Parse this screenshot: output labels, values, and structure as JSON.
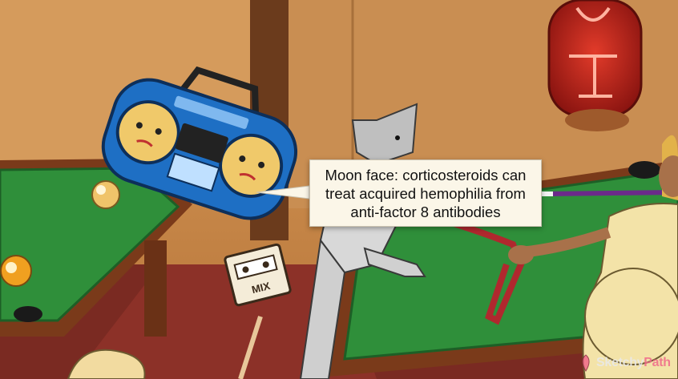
{
  "callout": {
    "line1": "Moon face: corticosteroids can",
    "line2": "treat acquired hemophilia from",
    "line3": "anti-factor 8 antibodies"
  },
  "cassette": {
    "label": "MIX"
  },
  "watermark": {
    "part1": "Sketchy",
    "part2": "Path"
  },
  "colors": {
    "wall": "#c98a4a",
    "felt": "#2f8f3a",
    "floor": "#7a2a22",
    "boombox": "#1e6fc4",
    "callout_bg": "#fbf6e8",
    "watermark_accent": "#f06a8a"
  },
  "icons": [
    "boombox-icon",
    "cassette-icon",
    "cue-ball-icon",
    "pool-cue-icon",
    "wall-lamp-icon",
    "logo-icon"
  ]
}
